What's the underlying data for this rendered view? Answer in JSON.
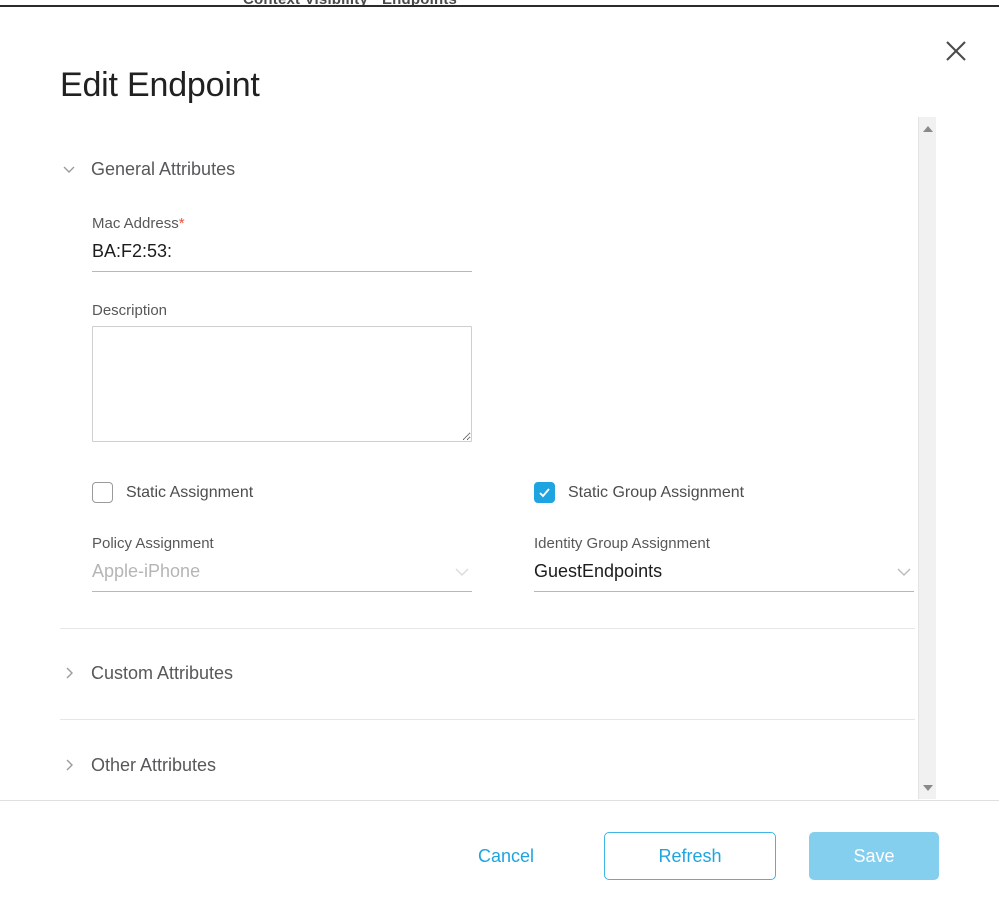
{
  "background": {
    "breadcrumb": "Context Visibility · Endpoints"
  },
  "dialog": {
    "title": "Edit Endpoint",
    "close_label": "×"
  },
  "sections": {
    "general": {
      "label": "General Attributes",
      "expanded": true,
      "chevron": "chevron-down-icon"
    },
    "custom": {
      "label": "Custom Attributes",
      "expanded": false,
      "chevron": "chevron-right-icon"
    },
    "other": {
      "label": "Other Attributes",
      "expanded": false,
      "chevron": "chevron-right-icon"
    }
  },
  "form": {
    "mac_address": {
      "label": "Mac Address",
      "required_marker": "*",
      "value": "BA:F2:53:",
      "placeholder": ""
    },
    "description": {
      "label": "Description",
      "value": "",
      "placeholder": ""
    },
    "static_assignment": {
      "label": "Static Assignment",
      "checked": false
    },
    "static_group_assignment": {
      "label": "Static Group Assignment",
      "checked": true
    },
    "policy_assignment": {
      "label": "Policy Assignment",
      "value": "Apple-iPhone",
      "disabled": true,
      "chevron": "chevron-down-icon"
    },
    "identity_group_assignment": {
      "label": "Identity Group Assignment",
      "value": "GuestEndpoints",
      "disabled": false,
      "chevron": "chevron-down-icon"
    }
  },
  "scrollbar": {
    "up_icon": "triangle-up-icon",
    "down_icon": "triangle-down-icon"
  },
  "footer": {
    "cancel_label": "Cancel",
    "refresh_label": "Refresh",
    "save_label": "Save"
  },
  "colors": {
    "accent_blue": "#1ea4e0",
    "button_outline_blue": "#41b6e6",
    "save_disabled_blue": "#85cfee",
    "required_red": "#e8503a",
    "label_gray": "#58585b",
    "disabled_text": "#b5b5b5",
    "divider": "#e6e6e6"
  }
}
